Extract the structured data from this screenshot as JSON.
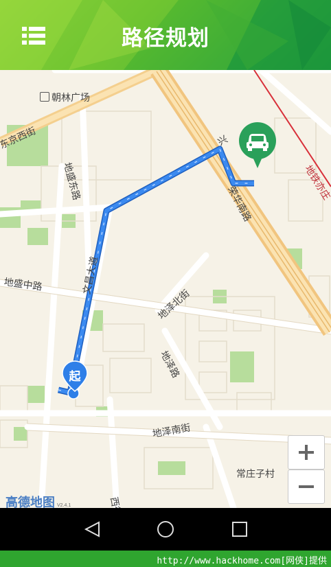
{
  "header": {
    "title": "路径规划",
    "menu_icon": "list-menu-icon"
  },
  "map": {
    "labels": {
      "chaolin": "朝林广场",
      "dongjing_west": "东京西街",
      "disheng_east": "地盛东路",
      "disheng_middle": "地盛中路",
      "wenchang": "文昌大道",
      "ze_north": "地泽北街",
      "ze_road": "地泽路",
      "ze_south": "地泽南街",
      "ronghua_south": "荣华南路",
      "metro": "地铁亦庄",
      "changzhuang": "常庄子村",
      "xi": "西街",
      "xing": "兴"
    },
    "start_marker": "起",
    "destination_icon": "car-icon",
    "logo": "高德地图",
    "logo_version": "V2.4.1",
    "accent_route": "#3b7fe0",
    "accent_marker": "#2aa05a"
  },
  "zoom": {
    "in_icon": "plus-icon",
    "out_icon": "minus-icon"
  },
  "navbar": {
    "back_icon": "back-triangle-icon",
    "home_icon": "home-circle-icon",
    "recent_icon": "recent-square-icon"
  },
  "footer": {
    "text": "http://www.hackhome.com[网侠]提供"
  }
}
